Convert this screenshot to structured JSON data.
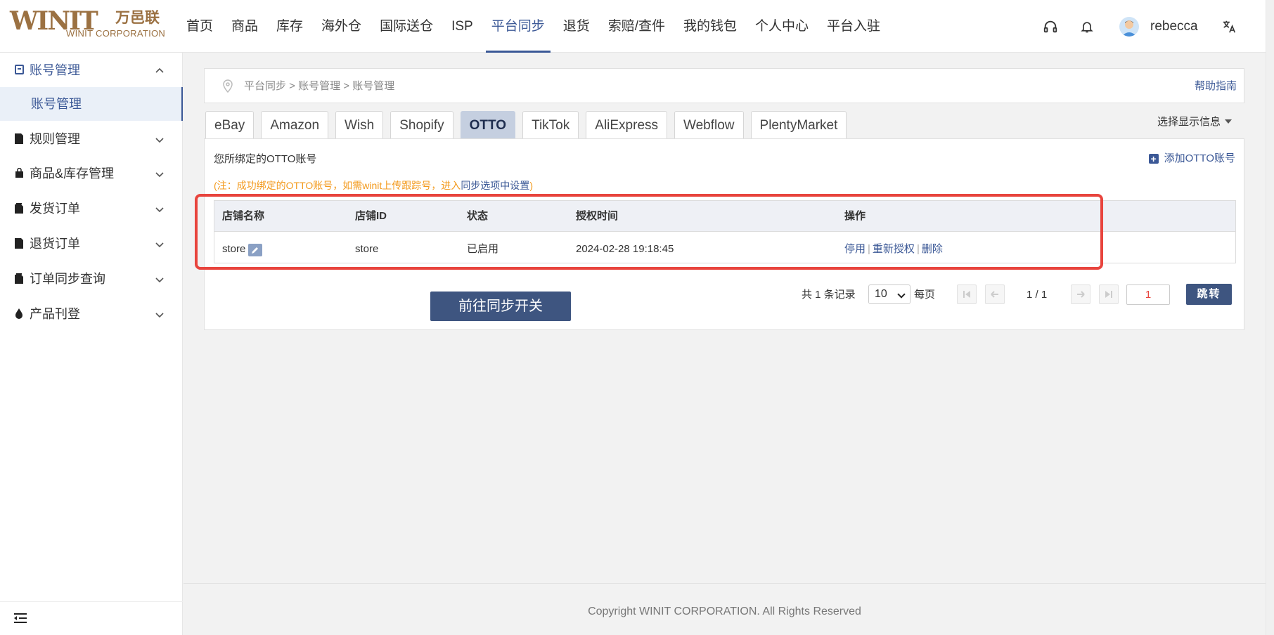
{
  "logo": {
    "mark": "WINIT",
    "cn": "万邑联",
    "en": "WINIT CORPORATION"
  },
  "nav": {
    "items": [
      {
        "label": "首页"
      },
      {
        "label": "商品"
      },
      {
        "label": "库存"
      },
      {
        "label": "海外仓"
      },
      {
        "label": "国际送仓"
      },
      {
        "label": "ISP"
      },
      {
        "label": "平台同步"
      },
      {
        "label": "退货"
      },
      {
        "label": "索赔/查件"
      },
      {
        "label": "我的钱包"
      },
      {
        "label": "个人中心"
      },
      {
        "label": "平台入驻"
      }
    ],
    "active_label": "平台同步"
  },
  "user": {
    "name": "rebecca"
  },
  "sidebar": {
    "items": [
      {
        "label": "账号管理",
        "icon": "account-icon"
      },
      {
        "label": "规则管理",
        "icon": "rules-icon"
      },
      {
        "label": "商品&库存管理",
        "icon": "bag-icon"
      },
      {
        "label": "发货订单",
        "icon": "document-icon"
      },
      {
        "label": "退货订单",
        "icon": "document-icon"
      },
      {
        "label": "订单同步查询",
        "icon": "document-icon"
      },
      {
        "label": "产品刊登",
        "icon": "drop-icon"
      }
    ],
    "sub_item": "账号管理"
  },
  "breadcrumb": {
    "text": "平台同步 > 账号管理 > 账号管理",
    "help": "帮助指南"
  },
  "tabs": [
    "eBay",
    "Amazon",
    "Wish",
    "Shopify",
    "OTTO",
    "TikTok",
    "AliExpress",
    "Webflow",
    "PlentyMarket"
  ],
  "active_tab": "OTTO",
  "display_select": "选择显示信息",
  "panel": {
    "title": "您所绑定的OTTO账号",
    "add_label": "添加OTTO账号",
    "note_prefix": "(注：成功绑定的OTTO账号，如需winit上传跟踪号，进入",
    "note_link": "同步选项中设置",
    "note_suffix": ")"
  },
  "table": {
    "headers": [
      "店铺名称",
      "店铺ID",
      "状态",
      "授权时间",
      "操作"
    ],
    "rows": [
      {
        "name": "store",
        "id": "store",
        "status": "已启用",
        "auth_time": "2024-02-28 19:18:45",
        "ops": [
          "停用",
          "重新授权",
          "删除"
        ]
      }
    ]
  },
  "goto_sync": "前往同步开关",
  "pager": {
    "total": "共 1 条记录",
    "page_size": "10",
    "per_page": "每页",
    "page_num": "1 / 1",
    "jump_value": "1",
    "jump_label": "跳转"
  },
  "footer": "Copyright WINIT CORPORATION. All Rights Reserved",
  "colors": {
    "primary": "#3b5896",
    "accent": "#9b7142",
    "note": "#f39a1d",
    "highlight": "#e8443d"
  }
}
